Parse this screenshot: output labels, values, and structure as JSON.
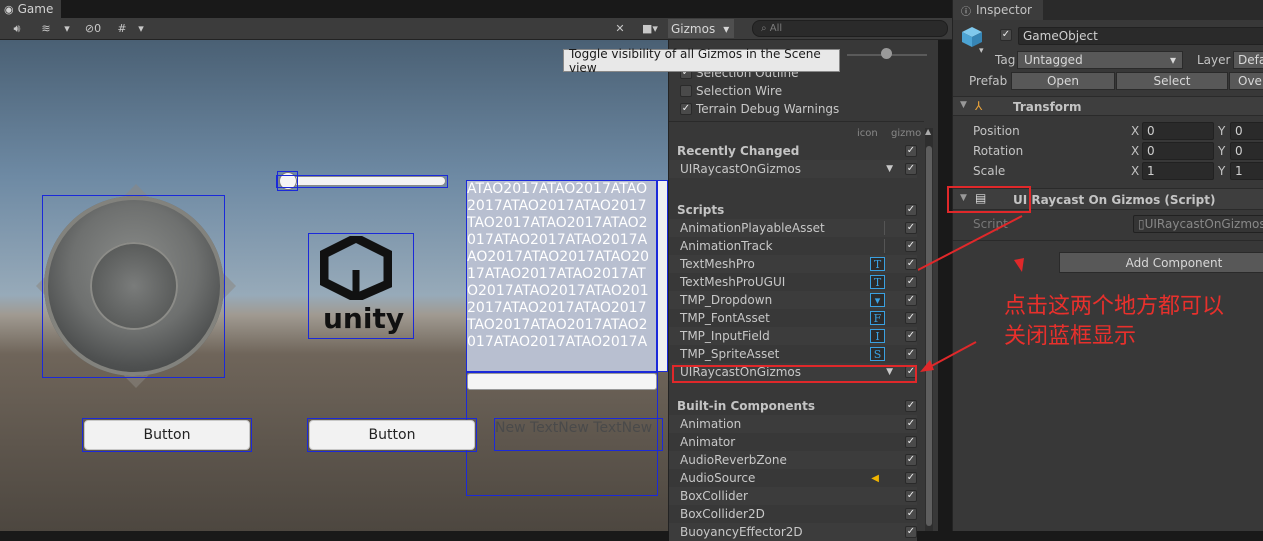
{
  "game_tab": {
    "title": "Game"
  },
  "game_toolbar": {
    "audio_icon": "speaker-icon",
    "stats_icon": "stack-icon",
    "hidden_count": "0",
    "gizmos_label": "Gizmos",
    "search_placeholder": "All"
  },
  "tooltip": {
    "text": "Toggle visibility of all Gizmos in the Scene view"
  },
  "gizmos_panel": {
    "top_options": [
      {
        "label": "Selection Outline",
        "checked": true
      },
      {
        "label": "Selection Wire",
        "checked": false
      },
      {
        "label": "Terrain Debug Warnings",
        "checked": true
      }
    ],
    "col_icon": "icon",
    "col_gizmo": "gizmo",
    "recently_changed": {
      "title": "Recently Changed",
      "items": [
        {
          "label": "UIRaycastOnGizmos"
        }
      ]
    },
    "scripts": {
      "title": "Scripts",
      "items": [
        {
          "label": "AnimationPlayableAsset",
          "icon": ""
        },
        {
          "label": "AnimationTrack",
          "icon": ""
        },
        {
          "label": "TextMeshPro",
          "icon": "T"
        },
        {
          "label": "TextMeshProUGUI",
          "icon": "T"
        },
        {
          "label": "TMP_Dropdown",
          "icon": "▾"
        },
        {
          "label": "TMP_FontAsset",
          "icon": "F"
        },
        {
          "label": "TMP_InputField",
          "icon": "I"
        },
        {
          "label": "TMP_SpriteAsset",
          "icon": "S"
        },
        {
          "label": "UIRaycastOnGizmos",
          "icon": ""
        }
      ]
    },
    "builtin": {
      "title": "Built-in Components",
      "items": [
        {
          "label": "Animation"
        },
        {
          "label": "Animator"
        },
        {
          "label": "AudioReverbZone"
        },
        {
          "label": "AudioSource"
        },
        {
          "label": "BoxCollider"
        },
        {
          "label": "BoxCollider2D"
        },
        {
          "label": "BuoyancyEffector2D"
        }
      ]
    }
  },
  "scene": {
    "button1": "Button",
    "button2": "Button",
    "newtext": "New TextNew TextNew",
    "logo_text": "unity",
    "text_lines": [
      "ATAO2017ATAO2017ATAO",
      "2017ATAO2017ATAO2017",
      "TAO2017ATAO2017ATAO2",
      "017ATAO2017ATAO2017A",
      "AO2017ATAO2017ATAO20",
      "17ATAO2017ATAO2017AT",
      "O2017ATAO2017ATAO201",
      "2017ATAO2017ATAO2017",
      "TAO2017ATAO2017ATAO2",
      "017ATAO2017ATAO2017A"
    ]
  },
  "inspector": {
    "tab": "Inspector",
    "object_name": "GameObject",
    "tag_label": "Tag",
    "tag_value": "Untagged",
    "layer_label": "Layer",
    "layer_value": "Defa",
    "prefab_label": "Prefab",
    "open": "Open",
    "select": "Select",
    "overrides": "Ove",
    "transform": {
      "title": "Transform",
      "position": {
        "label": "Position",
        "x": "0",
        "y": "0"
      },
      "rotation": {
        "label": "Rotation",
        "x": "0",
        "y": "0"
      },
      "scale": {
        "label": "Scale",
        "x": "1",
        "y": "1"
      }
    },
    "axis_x": "X",
    "axis_y": "Y",
    "script_component": {
      "title": "UI Raycast On Gizmos (Script)",
      "script_label": "Script",
      "script_value": "UIRaycastOnGizmos"
    },
    "add_component": "Add Component"
  },
  "annotation": {
    "line1": "点击这两个地方都可以",
    "line2": "关闭蓝框显示"
  },
  "colors": {
    "gizmo_blue": "#1b29d9",
    "annotation_red": "#e0282a",
    "accent_blue": "#3aa0e0"
  }
}
